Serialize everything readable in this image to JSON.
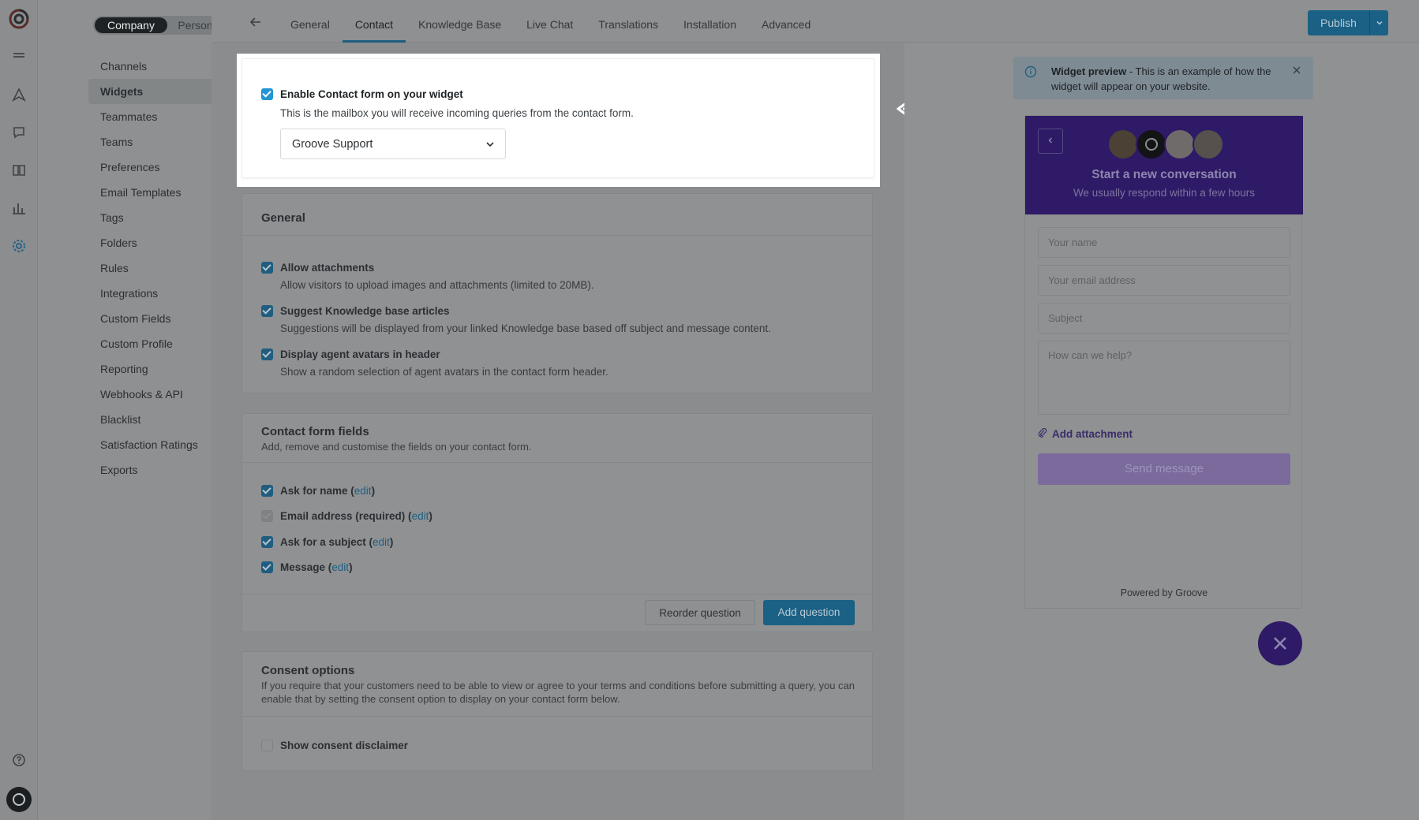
{
  "workspace_toggle": {
    "company": "Company",
    "personal": "Personal"
  },
  "sidebar": {
    "items": [
      {
        "label": "Channels"
      },
      {
        "label": "Widgets"
      },
      {
        "label": "Teammates"
      },
      {
        "label": "Teams"
      },
      {
        "label": "Preferences"
      },
      {
        "label": "Email Templates"
      },
      {
        "label": "Tags"
      },
      {
        "label": "Folders"
      },
      {
        "label": "Rules"
      },
      {
        "label": "Integrations"
      },
      {
        "label": "Custom Fields"
      },
      {
        "label": "Custom Profile"
      },
      {
        "label": "Reporting"
      },
      {
        "label": "Webhooks & API"
      },
      {
        "label": "Blacklist"
      },
      {
        "label": "Satisfaction Ratings"
      },
      {
        "label": "Exports"
      }
    ],
    "active_label": "Widgets"
  },
  "tabs": [
    {
      "label": "General"
    },
    {
      "label": "Contact"
    },
    {
      "label": "Knowledge Base"
    },
    {
      "label": "Live Chat"
    },
    {
      "label": "Translations"
    },
    {
      "label": "Installation"
    },
    {
      "label": "Advanced"
    }
  ],
  "active_tab": "Contact",
  "publish": {
    "label": "Publish"
  },
  "enable_contact": {
    "label": "Enable Contact form on your widget",
    "description": "This is the mailbox you will receive incoming queries from the contact form.",
    "mailbox_value": "Groove Support",
    "checked": true
  },
  "general_card": {
    "title": "General",
    "options": [
      {
        "label": "Allow attachments",
        "description": "Allow visitors to upload images and attachments (limited to 20MB).",
        "checked": true
      },
      {
        "label": "Suggest Knowledge base articles",
        "description": "Suggestions will be displayed from your linked Knowledge base based off subject and message content.",
        "checked": true
      },
      {
        "label": "Display agent avatars in header",
        "description": "Show a random selection of agent avatars in the contact form header.",
        "checked": true
      }
    ]
  },
  "fields_card": {
    "title": "Contact form fields",
    "subtitle": "Add, remove and customise the fields on your contact form.",
    "fields": [
      {
        "label": "Ask for name (",
        "edit": "edit",
        "close": ")",
        "state": "checked"
      },
      {
        "label": "Email address (required) (",
        "edit": "edit",
        "close": ")",
        "state": "disabled"
      },
      {
        "label": "Ask for a subject (",
        "edit": "edit",
        "close": ")",
        "state": "checked"
      },
      {
        "label": "Message (",
        "edit": "edit",
        "close": ")",
        "state": "checked"
      }
    ],
    "reorder_label": "Reorder question",
    "add_label": "Add question"
  },
  "consent_card": {
    "title": "Consent options",
    "description": "If you require that your customers need to be able to view or agree to your terms and conditions before submitting a query, you can enable that by setting the consent option to display on your contact form below.",
    "option_label": "Show consent disclaimer",
    "checked": false
  },
  "preview_notice": {
    "bold": "Widget preview",
    "text": " - This is an example of how the widget will appear on your website."
  },
  "widget": {
    "title": "Start a new conversation",
    "subtitle": "We usually respond within a few hours",
    "name_placeholder": "Your name",
    "email_placeholder": "Your email address",
    "subject_placeholder": "Subject",
    "message_placeholder": "How can we help?",
    "attach_label": "Add attachment",
    "send_label": "Send message",
    "powered_by": "Powered by Groove"
  },
  "colors": {
    "brand_blue": "#2196d3",
    "widget_purple": "#3a1f8a",
    "overlay_dim": "#8f9192"
  }
}
